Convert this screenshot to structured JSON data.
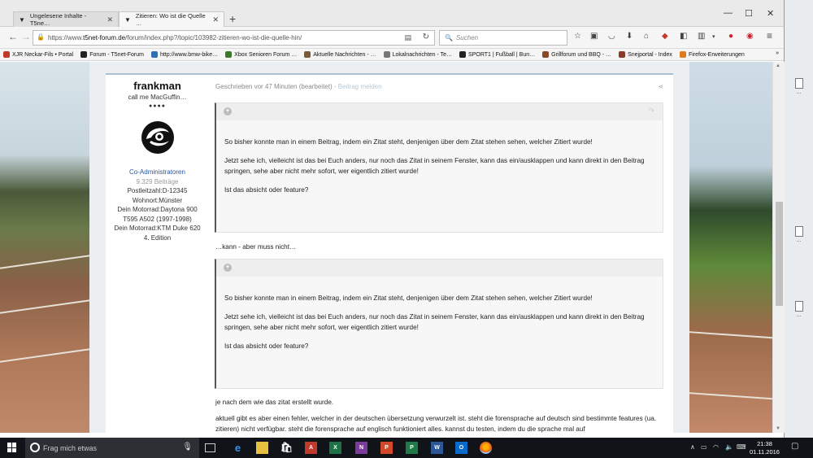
{
  "browser": {
    "tabs": [
      {
        "label": "Ungelesene Inhalte - T5ne…",
        "active": false
      },
      {
        "label": "Zitieren: Wo ist die Quelle …",
        "active": true
      }
    ],
    "new_tab": "+",
    "window_controls": {
      "minimize": "—",
      "maximize": "☐",
      "close": "✕"
    },
    "url_prefix": "https://www.",
    "url_host": "t5net-forum.de",
    "url_path": "/forum/index.php?/topic/103982-zitieren-wo-ist-die-quelle-hin/",
    "search_placeholder": "Suchen",
    "bookmarks": [
      {
        "label": "XJR Neckar-Fils • Portal",
        "color": "#c0392b"
      },
      {
        "label": "Forum - T5net-Forum",
        "color": "#222222"
      },
      {
        "label": "http://www.bmw-bike…",
        "color": "#2c6fb5"
      },
      {
        "label": "Xbox Senioren Forum …",
        "color": "#3a7a2a"
      },
      {
        "label": "Aktuelle Nachrichten - …",
        "color": "#7a5a3a"
      },
      {
        "label": "Lokalnachrichten - Te…",
        "color": "#777777"
      },
      {
        "label": "SPORT1 | Fußball | Bun…",
        "color": "#222222"
      },
      {
        "label": "Grillforum und BBQ - …",
        "color": "#8a4a2a"
      },
      {
        "label": "Snejportal - Index",
        "color": "#8a3a2a"
      },
      {
        "label": "Firefox-Erweiterungen",
        "color": "#e07a20"
      }
    ],
    "bookmarks_overflow": "»"
  },
  "post": {
    "author": {
      "name": "frankman",
      "title": "call me MacGuffin…",
      "rank_dots": "●●●●",
      "group": "Co-Administratoren",
      "posts": "9.329 Beiträge",
      "fields": [
        "Postleitzahl:D-12345",
        "Wohnort:Münster",
        "Dein Motorrad:Daytona 900",
        "T595 A502 (1997-1998)",
        "Dein Motorrad:KTM Duke 620",
        "4. Edition"
      ]
    },
    "meta": "Geschrieben vor 47 Minuten (bearbeitet)",
    "meta_sep": " · ",
    "report": "Beitrag melden",
    "share_icon": "share-icon",
    "quote1": {
      "p1": "So bisher konnte man in einem Beitrag, indem ein Zitat steht, denjenigen über dem Zitat stehen sehen, welcher Zitiert wurde!",
      "p2": "Jetzt sehe ich, vielleicht ist das bei Euch anders, nur noch das Zitat in seinem Fenster, kann das ein/ausklappen und kann direkt in den Beitrag springen, sehe aber nicht mehr sofort, wer eigentlich zitiert wurde!",
      "p3": "Ist das absicht oder feature?"
    },
    "between": "…kann - aber muss nicht…",
    "quote2": {
      "p1": "So bisher konnte man in einem Beitrag, indem ein Zitat steht, denjenigen über dem Zitat stehen sehen, welcher Zitiert wurde!",
      "p2": "Jetzt sehe ich, vielleicht ist das bei Euch anders, nur noch das Zitat in seinem Fenster, kann das ein/ausklappen und kann direkt in den Beitrag springen, sehe aber nicht mehr sofort, wer eigentlich zitiert wurde!",
      "p3": "Ist das absicht oder feature?"
    },
    "after1": "je nach dem wie das zitat erstellt wurde.",
    "after2": "aktuell gibt es aber einen fehler, welcher in der deutschen übersetzung verwurzelt ist. steht die forensprache auf deutsch sind bestimmte features (ua. zitieren) nicht verfügbar. steht die forensprache auf englisch funktioniert alles. kannst du testen, indem du die sprache mal auf"
  },
  "taskbar": {
    "search_placeholder": "Frag mich etwas",
    "time": "21:38",
    "date": "01.11.2016"
  },
  "desktop": {
    "icon1_label": "…",
    "icon2_label": "…",
    "icon3_label": "…"
  },
  "colors": {
    "accent": "#2a56a0",
    "post_border": "#aac0cf"
  }
}
